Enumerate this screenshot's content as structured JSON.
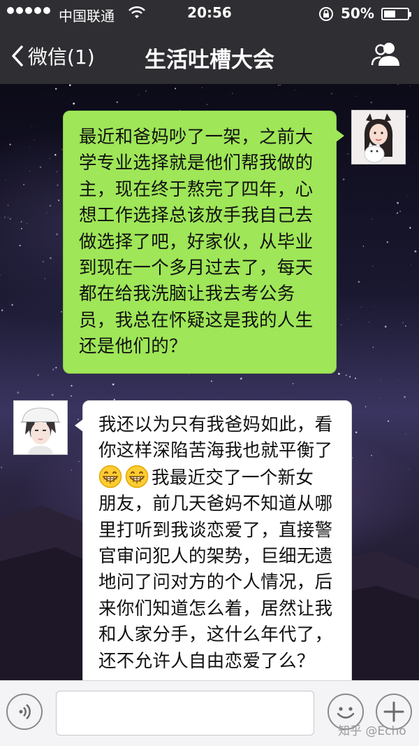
{
  "status_bar": {
    "carrier": "中国联通",
    "time": "20:56",
    "battery": "50%",
    "battery_level": 0.5
  },
  "nav": {
    "back_label": "微信(1)",
    "title": "生活吐槽大会",
    "right_icon": "people-icon"
  },
  "messages": [
    {
      "side": "right",
      "bubble_color": "#9fe658",
      "lines": [
        "最近和爸妈吵了一架，之前大",
        "学专业选择就是他们帮我做的",
        "主，现在终于熬完了四年，心",
        "想工作选择总该放手我自己去",
        "做选择了吧，好家伙，从毕业",
        "到现在一个多月过去了，每天",
        "都在给我洗脑让我去考公务",
        "员，我总在怀疑这是我的人生",
        "还是他们的？"
      ]
    },
    {
      "side": "left",
      "bubble_color": "#ffffff",
      "lines": [
        "我还以为只有我爸妈如此，看",
        "你这样深陷苦海我也就平衡了",
        "我最近交了一个新女",
        "朋友，前几天爸妈不知道从哪",
        "里打听到我谈恋爱了，直接警",
        "官审问犯人的架势，巨细无遗",
        "地问了问对方的个人情况，后",
        "来你们知道怎么着，居然让我",
        "和人家分手，这什么年代了，",
        "还不允许人自由恋爱了么？"
      ],
      "emoji": [
        "grin-emoji",
        "grin-emoji"
      ]
    }
  ],
  "input_bar": {
    "voice_icon": "voice-icon",
    "emoji_icon": "smiley-icon",
    "plus_icon": "plus-icon",
    "text_value": ""
  },
  "watermark": "知乎 @Echo",
  "colors": {
    "bar_bg": "#2e2e33",
    "green_bubble": "#9fe658",
    "white_bubble": "#ffffff"
  }
}
